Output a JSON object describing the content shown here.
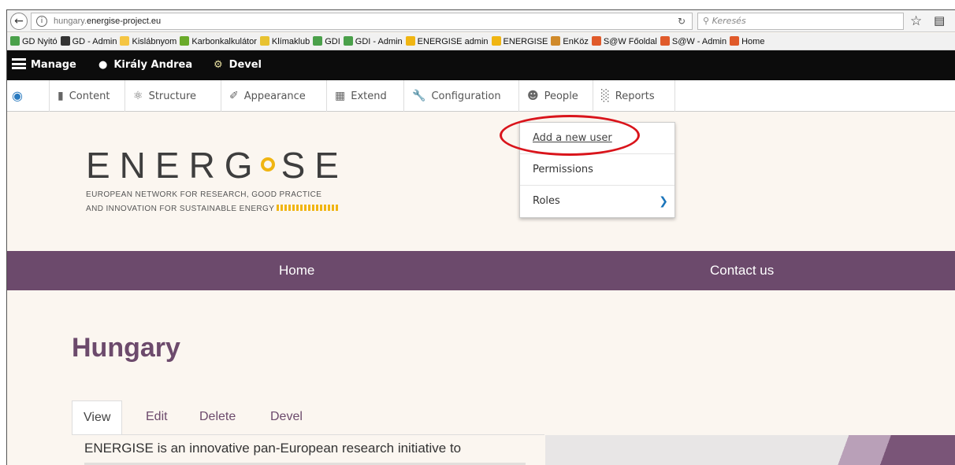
{
  "browser": {
    "url_host": "hungary.",
    "url_domain": "energise-project.eu",
    "search_placeholder": "Keresés"
  },
  "bookmarks": [
    {
      "label": "GD Nyitó",
      "color": "#4aa04a"
    },
    {
      "label": "GD - Admin",
      "color": "#333"
    },
    {
      "label": "Kislábnyom",
      "color": "#f5c542"
    },
    {
      "label": "Karbonkalkulátor",
      "color": "#6aaa2a"
    },
    {
      "label": "Klímaklub",
      "color": "#e8c230"
    },
    {
      "label": "GDI",
      "color": "#4aa04a"
    },
    {
      "label": "GDI - Admin",
      "color": "#4aa04a"
    },
    {
      "label": "ENERGISE admin",
      "color": "#f0b512"
    },
    {
      "label": "ENERGISE",
      "color": "#f0b512"
    },
    {
      "label": "EnKöz",
      "color": "#d08a2a"
    },
    {
      "label": "S@W Főoldal",
      "color": "#e05a2a"
    },
    {
      "label": "S@W - Admin",
      "color": "#e05a2a"
    },
    {
      "label": "Home",
      "color": "#e05a2a"
    }
  ],
  "adminbar": {
    "manage": "Manage",
    "user": "Király Andrea",
    "devel": "Devel"
  },
  "toolbar": {
    "items": [
      "Content",
      "Structure",
      "Appearance",
      "Extend",
      "Configuration",
      "People",
      "Reports"
    ]
  },
  "people_menu": {
    "items": [
      "Add a new user",
      "Permissions",
      "Roles"
    ]
  },
  "logo": {
    "word_left": "ENERG",
    "word_right": "SE",
    "subtitle_1": "EUROPEAN NETWORK FOR RESEARCH, GOOD PRACTICE",
    "subtitle_2": "AND INNOVATION FOR SUSTAINABLE ENERGY"
  },
  "nav": {
    "home": "Home",
    "contact": "Contact us"
  },
  "page": {
    "title": "Hungary",
    "tabs": [
      "View",
      "Edit",
      "Delete",
      "Devel"
    ],
    "body": "ENERGISE is an innovative pan-European research initiative to"
  },
  "colors": {
    "accent": "#6c4a6c",
    "highlight": "#d9141b",
    "logo_yellow": "#f0b512"
  }
}
